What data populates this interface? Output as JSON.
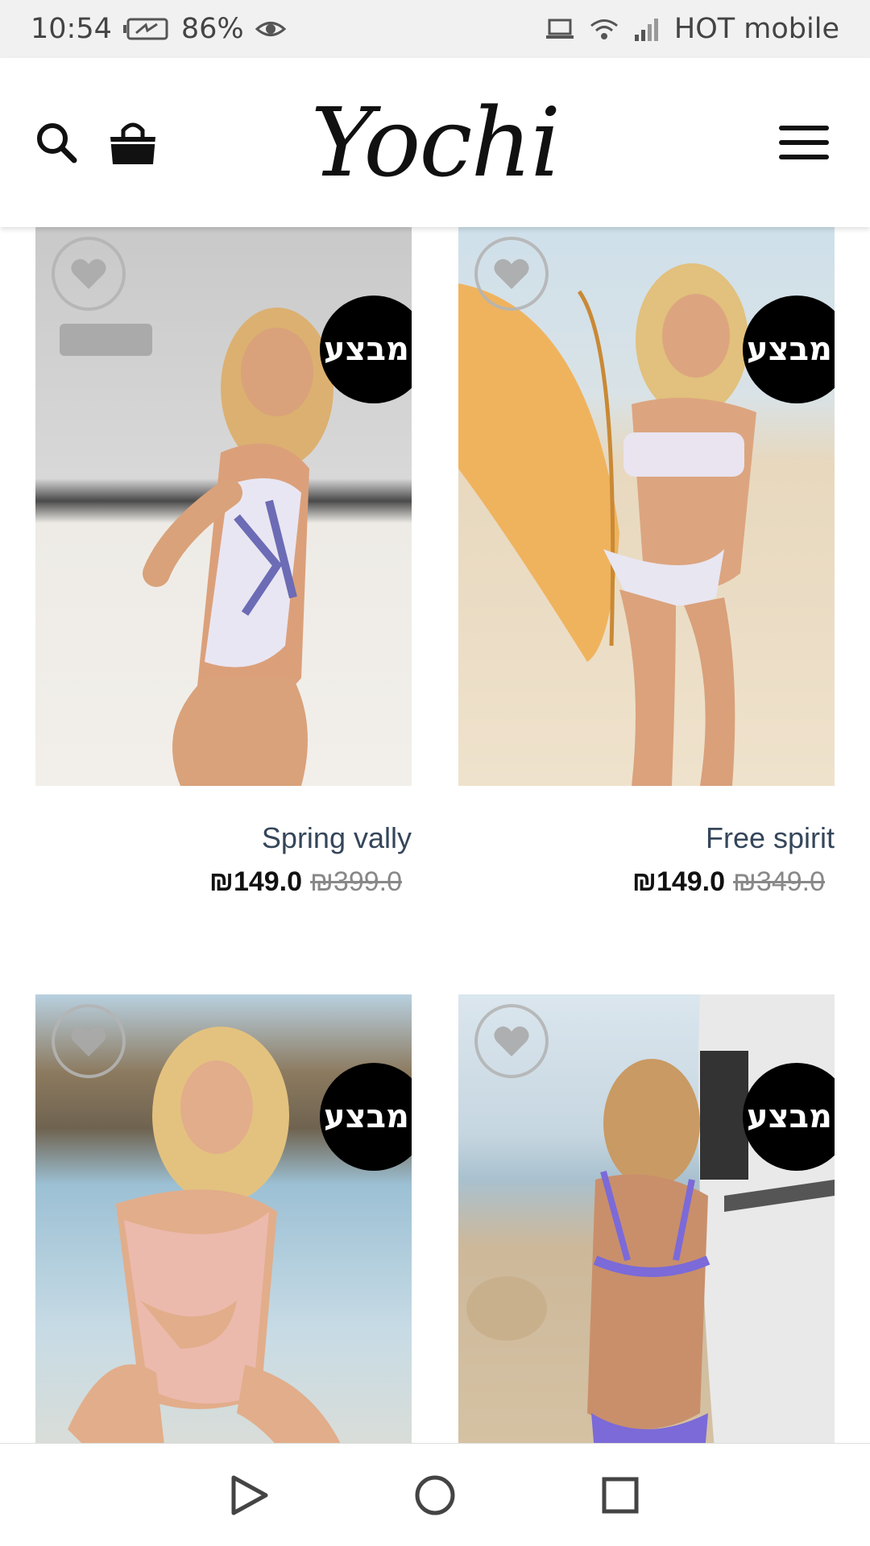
{
  "status_bar": {
    "time": "10:54",
    "battery": "86%",
    "carrier": "HOT mobile"
  },
  "header": {
    "logo": "Yochi"
  },
  "products": [
    {
      "name": "Spring vally",
      "price": "₪149.0",
      "old_price": "₪399.0",
      "badge": "מבצע!",
      "image_colors": [
        "#cfcfcf",
        "#e9e6e1",
        "#d7a37b"
      ]
    },
    {
      "name": "Free spirit",
      "price": "₪149.0",
      "old_price": "₪349.0",
      "badge": "מבצע!",
      "image_colors": [
        "#c9dbe5",
        "#e6d6bb",
        "#d9a273"
      ]
    },
    {
      "name": "",
      "price": "",
      "old_price": "",
      "badge": "מבצע!",
      "image_colors": [
        "#9fbacb",
        "#b9a587",
        "#e8b6a7"
      ]
    },
    {
      "name": "",
      "price": "",
      "old_price": "",
      "badge": "מבצע!",
      "image_colors": [
        "#cfe0ea",
        "#d8c6a9",
        "#7b6ad8"
      ]
    }
  ],
  "colors": {
    "badge_bg": "#000000",
    "product_name": "#35465a",
    "status_bar_bg": "#f1f1f1"
  }
}
